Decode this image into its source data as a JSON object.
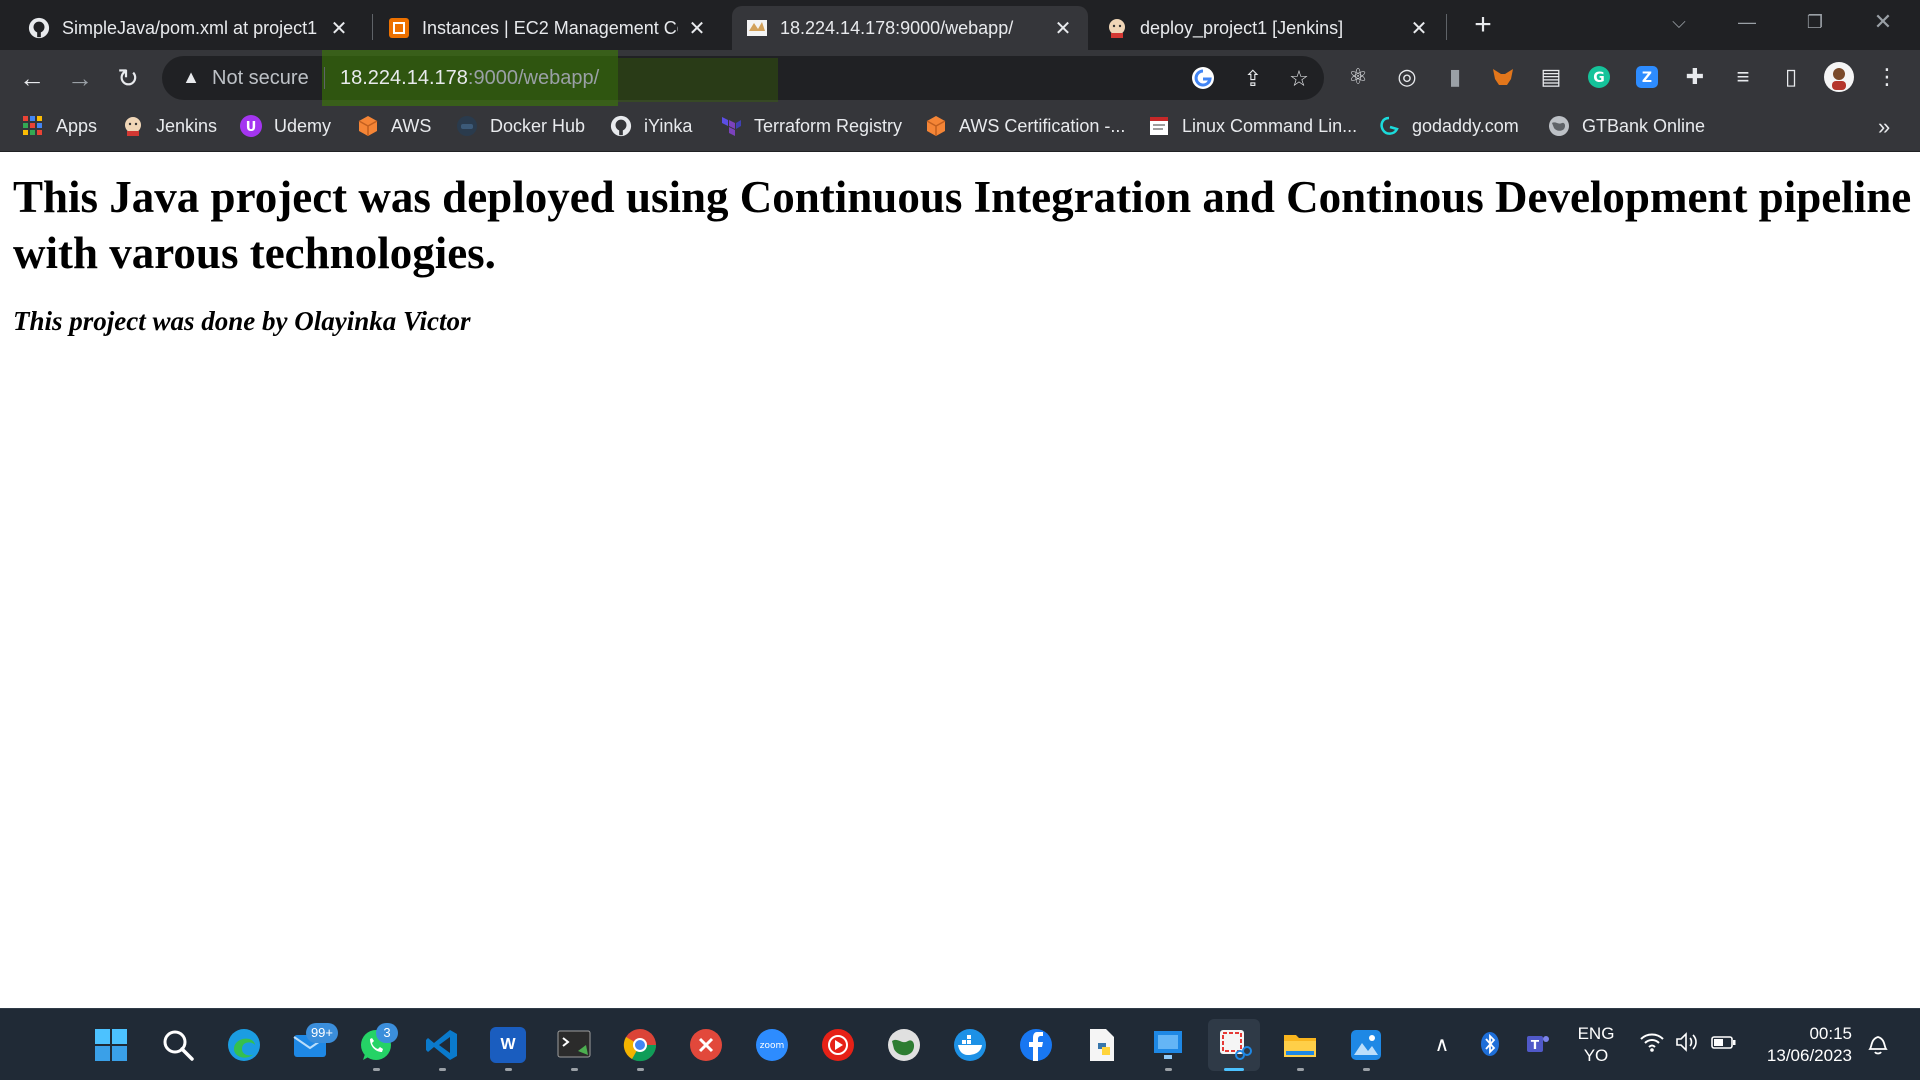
{
  "browser": {
    "tabs": [
      {
        "title": "SimpleJava/pom.xml at project1 ·",
        "icon": "github-icon",
        "active": false
      },
      {
        "title": "Instances | EC2 Management Con",
        "icon": "aws-ec2-icon",
        "active": false
      },
      {
        "title": "18.224.14.178:9000/webapp/",
        "icon": "tomcat-icon",
        "active": true
      },
      {
        "title": "deploy_project1 [Jenkins]",
        "icon": "jenkins-icon",
        "active": false
      }
    ],
    "address_bar": {
      "security_label": "Not secure",
      "url_host": "18.224.14.178",
      "url_path": ":9000/webapp/"
    },
    "bookmarks": [
      {
        "label": "Apps",
        "icon": "apps-grid-icon"
      },
      {
        "label": "Jenkins",
        "icon": "jenkins-icon"
      },
      {
        "label": "Udemy",
        "icon": "udemy-icon"
      },
      {
        "label": "AWS",
        "icon": "aws-cube-icon"
      },
      {
        "label": "Docker Hub",
        "icon": "docker-icon"
      },
      {
        "label": "iYinka",
        "icon": "github-icon"
      },
      {
        "label": "Terraform Registry",
        "icon": "terraform-icon"
      },
      {
        "label": "AWS Certification -...",
        "icon": "aws-cube-icon"
      },
      {
        "label": "Linux Command Lin...",
        "icon": "document-icon"
      },
      {
        "label": "godaddy.com",
        "icon": "godaddy-icon"
      },
      {
        "label": "GTBank Online",
        "icon": "globe-icon"
      }
    ],
    "bookmarks_overflow": "»"
  },
  "page": {
    "heading": "This Java project was deployed using Continuous Integration and Continous Development pipeline with varous technologies.",
    "byline": "This project was done by Olayinka Victor"
  },
  "taskbar": {
    "mail_badge": "99+",
    "whatsapp_badge": "3",
    "language_line1": "ENG",
    "language_line2": "YO",
    "time": "00:15",
    "date": "13/06/2023"
  },
  "colors": {
    "tab_strip": "#202124",
    "toolbar": "#35363a",
    "url_highlight": "#3c8200",
    "taskbar": "#202a36"
  }
}
